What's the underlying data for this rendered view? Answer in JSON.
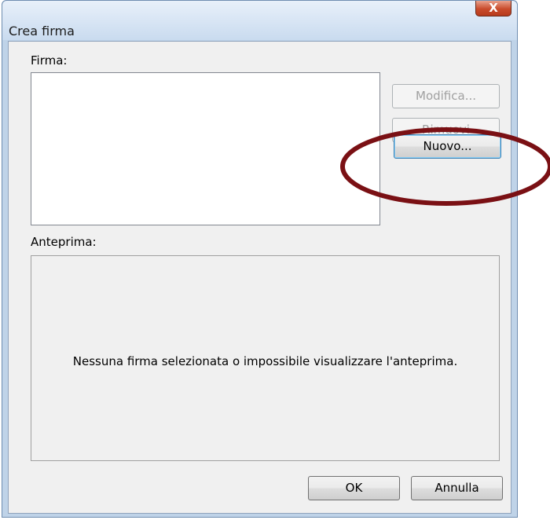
{
  "window": {
    "title": "Crea firma",
    "close_label": "X"
  },
  "signature": {
    "label": "Firma:",
    "items": []
  },
  "buttons": {
    "edit": "Modifica...",
    "remove": "Rimuovi",
    "new": "Nuovo...",
    "ok": "OK",
    "cancel": "Annulla"
  },
  "preview": {
    "label": "Anteprima:",
    "message": "Nessuna firma selezionata o impossibile visualizzare l'anteprima."
  },
  "colors": {
    "highlight": "#7a1014"
  }
}
